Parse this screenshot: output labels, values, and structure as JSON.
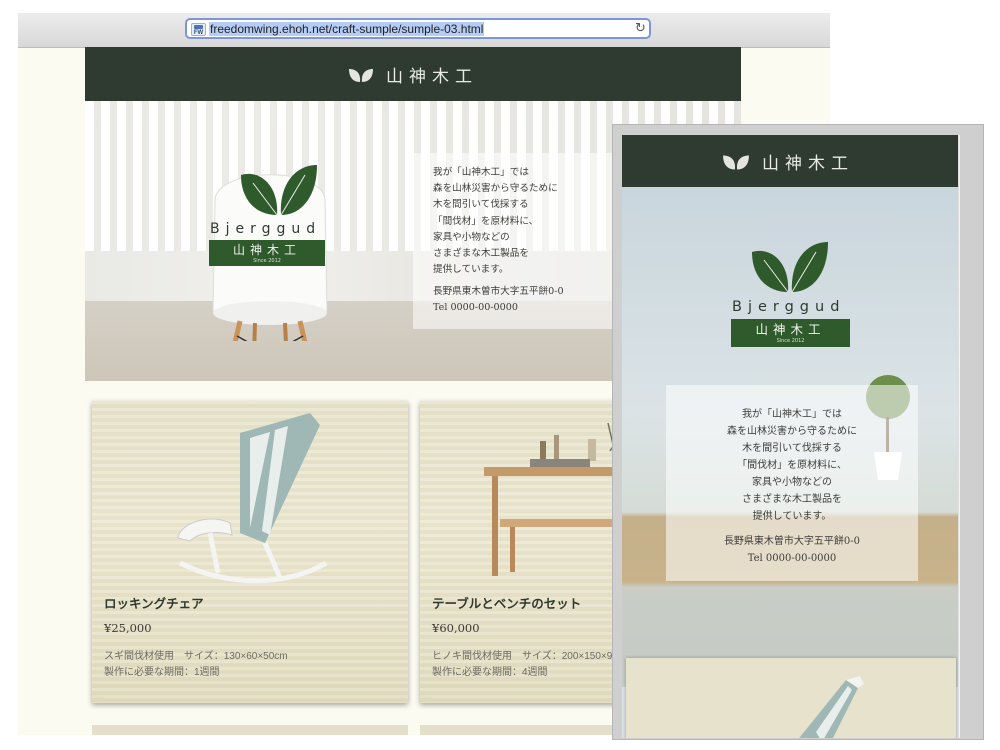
{
  "browser": {
    "favicon_text": "FW",
    "url": "freedomwing.ehoh.net/craft-sumple/sumple-03.html"
  },
  "site": {
    "name": "山神木工",
    "logo_latin": "Bjerggud",
    "logo_kanji": "山神木工",
    "since": "Since 2012"
  },
  "hero": {
    "intro_lines": [
      "我が「山神木工」では",
      "森を山林災害から守るために",
      "木を間引いて伐採する",
      "「間伐材」を原材料に、",
      "家具や小物などの",
      "さまざまな木工製品を",
      "提供しています。"
    ],
    "address": "長野県東木曽市大字五平餅0-0",
    "tel": "Tel 0000-00-0000"
  },
  "products": [
    {
      "title": "ロッキングチェア",
      "price": "¥25,000",
      "spec": "スギ間伐材使用　サイズ：130×60×50cm",
      "period": "製作に必要な期間：1週間"
    },
    {
      "title": "テーブルとベンチのセット",
      "price": "¥60,000",
      "spec": "ヒノキ間伐材使用　サイズ：200×150×9",
      "period": "製作に必要な期間：4週間"
    }
  ],
  "colors": {
    "header_bg": "#2f3b30",
    "logo_green": "#2f5a2c",
    "page_bg": "#fbfbf1",
    "url_focus": "#7d96d8"
  },
  "icons": [
    "leaf-icon",
    "reload-icon",
    "favicon-icon"
  ]
}
